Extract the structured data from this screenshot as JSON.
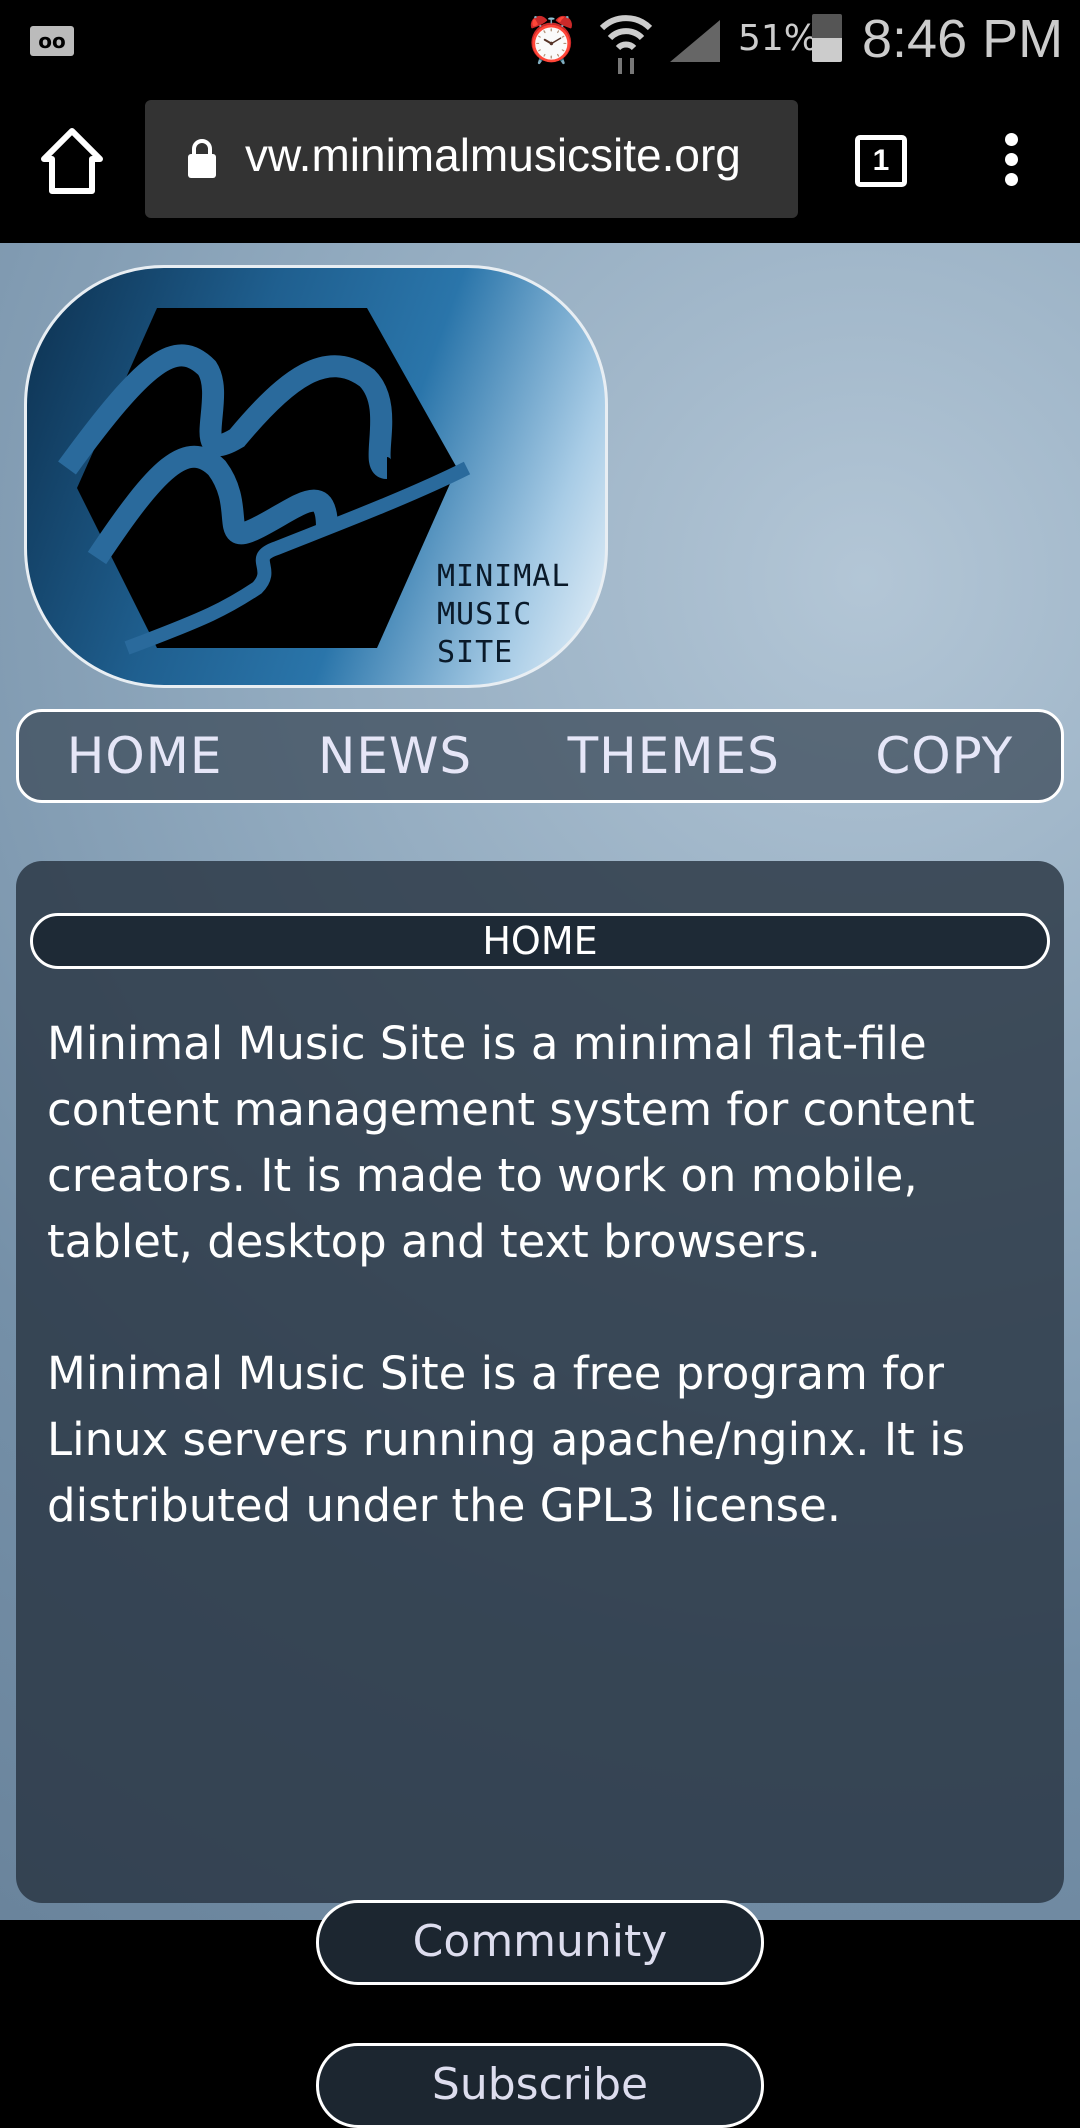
{
  "status_bar": {
    "voicemail_icon": "voicemail-icon",
    "battery_percent": "51%",
    "time": "8:46 PM"
  },
  "browser": {
    "url": "vw.minimalmusicsite.org",
    "tab_count": "1"
  },
  "logo": {
    "text_lines": [
      "MINIMAL",
      "MUSIC",
      "SITE"
    ]
  },
  "nav": {
    "items": [
      {
        "label": "HOME"
      },
      {
        "label": "NEWS"
      },
      {
        "label": "THEMES"
      },
      {
        "label": "COPY"
      }
    ]
  },
  "content": {
    "title": "HOME",
    "paragraphs": [
      "Minimal Music Site is a minimal flat-file content management system for content creators. It is made to work on mobile, tablet, desktop and text browsers.",
      "Minimal Music Site is a free program for Linux servers running apache/nginx. It is distributed under the GPL3 license."
    ],
    "buttons": {
      "community": "Community",
      "subscribe": "Subscribe"
    }
  },
  "colors": {
    "logo_blue": "#2a75aa",
    "panel_bg": "#28344a"
  }
}
